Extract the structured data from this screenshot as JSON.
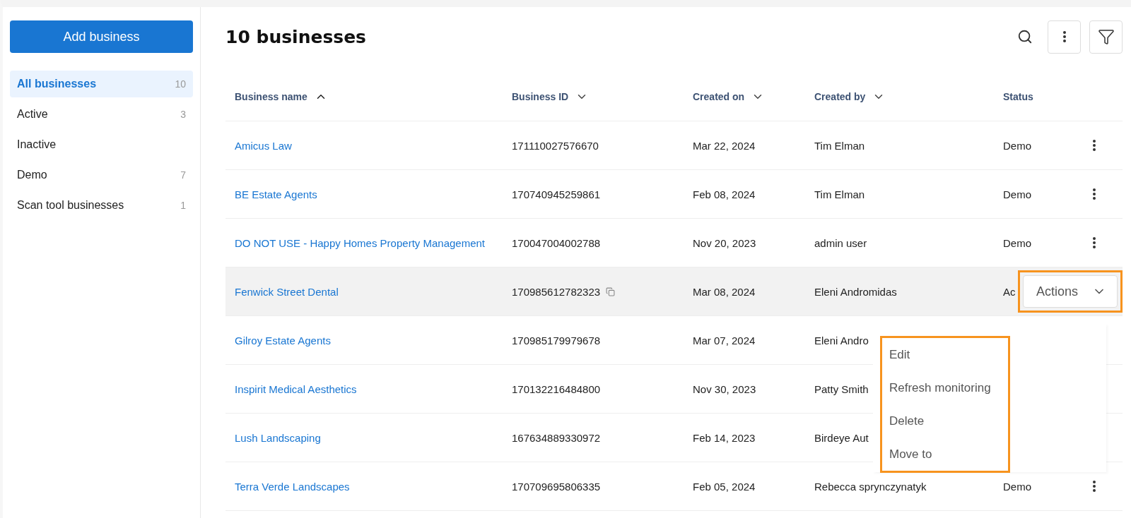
{
  "sidebar": {
    "add_button": "Add business",
    "filters": [
      {
        "label": "All businesses",
        "count": "10",
        "selected": true
      },
      {
        "label": "Active",
        "count": "3",
        "selected": false
      },
      {
        "label": "Inactive",
        "selected": false
      },
      {
        "label": "Demo",
        "count": "7",
        "selected": false
      },
      {
        "label": "Scan tool businesses",
        "count": "1",
        "selected": false
      }
    ]
  },
  "header": {
    "title": "10 businesses"
  },
  "table": {
    "columns": [
      {
        "label": "Business name",
        "kind": "ascending"
      },
      {
        "label": "Business ID",
        "kind": "descending"
      },
      {
        "label": "Created on",
        "kind": "descending"
      },
      {
        "label": "Created by",
        "kind": "descending"
      },
      {
        "label": "Status",
        "kind": "plain"
      }
    ],
    "rows": [
      {
        "name": "Amicus Law",
        "id": "171110027576670",
        "created_on": "Mar 22, 2024",
        "created_by": "Tim Elman",
        "status": "Demo",
        "hovered": false,
        "copyable": false,
        "kind": "kebab"
      },
      {
        "name": "BE Estate Agents",
        "id": "170740945259861",
        "created_on": "Feb 08, 2024",
        "created_by": "Tim Elman",
        "status": "Demo",
        "hovered": false,
        "copyable": false,
        "kind": "kebab"
      },
      {
        "name": "DO NOT USE - Happy Homes Property Management",
        "id": "170047004002788",
        "created_on": "Nov 20, 2023",
        "created_by": "admin user",
        "status": "Demo",
        "hovered": false,
        "copyable": false,
        "kind": "kebab"
      },
      {
        "name": "Fenwick Street Dental",
        "id": "170985612782323",
        "created_on": "Mar 08, 2024",
        "created_by": "Eleni Andromidas",
        "status": "Ac",
        "hovered": true,
        "copyable": true,
        "kind": "actions"
      },
      {
        "name": "Gilroy Estate Agents",
        "id": "170985179979678",
        "created_on": "Mar 07, 2024",
        "created_by": "Eleni Andro",
        "hovered": false,
        "copyable": false,
        "kind": "plain"
      },
      {
        "name": "Inspirit Medical Aesthetics",
        "id": "170132216484800",
        "created_on": "Nov 30, 2023",
        "created_by": "Patty Smith",
        "hovered": false,
        "copyable": false,
        "kind": "plain"
      },
      {
        "name": "Lush Landscaping",
        "id": "167634889330972",
        "created_on": "Feb 14, 2023",
        "created_by": "Birdeye Aut",
        "hovered": false,
        "copyable": false,
        "kind": "plain"
      },
      {
        "name": "Terra Verde Landscapes",
        "id": "170709695806335",
        "created_on": "Feb 05, 2024",
        "created_by": "Rebecca sprynczynatyk",
        "status": "Demo",
        "hovered": false,
        "copyable": false,
        "kind": "kebab"
      }
    ]
  },
  "actions_menu": {
    "button": "Actions",
    "items": [
      "Edit",
      "Refresh monitoring",
      "Delete",
      "Move to"
    ]
  }
}
